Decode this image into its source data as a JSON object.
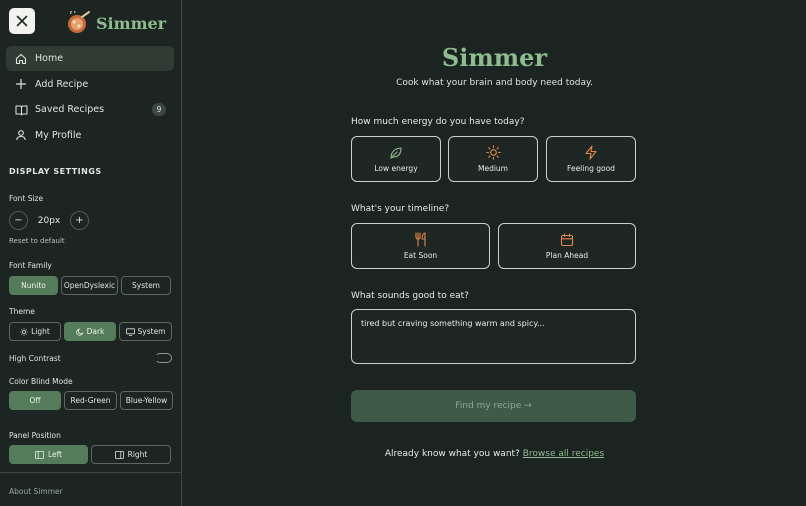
{
  "brand": {
    "name": "Simmer"
  },
  "nav": {
    "items": [
      {
        "label": "Home",
        "icon": "home-icon",
        "active": true
      },
      {
        "label": "Add Recipe",
        "icon": "plus-icon"
      },
      {
        "label": "Saved Recipes",
        "icon": "book-icon",
        "badge": "9"
      },
      {
        "label": "My Profile",
        "icon": "user-icon"
      }
    ]
  },
  "settings": {
    "title": "DISPLAY SETTINGS",
    "font_size": {
      "label": "Font Size",
      "value": "20px",
      "minus": "−",
      "plus": "+",
      "reset": "Reset to default"
    },
    "font_family": {
      "label": "Font Family",
      "options": [
        "Nunito",
        "OpenDyslexic",
        "System"
      ],
      "selected": "Nunito"
    },
    "theme": {
      "label": "Theme",
      "options": [
        "Light",
        "Dark",
        "System"
      ],
      "selected": "Dark"
    },
    "high_contrast": {
      "label": "High Contrast",
      "enabled": false
    },
    "color_blind": {
      "label": "Color Blind Mode",
      "options": [
        "Off",
        "Red-Green",
        "Blue-Yellow"
      ],
      "selected": "Off"
    },
    "panel_position": {
      "label": "Panel Position",
      "options": [
        "Left",
        "Right"
      ],
      "selected": "Left"
    },
    "about": "About Simmer"
  },
  "main": {
    "title": "Simmer",
    "subtitle": "Cook what your brain and body need today.",
    "energy": {
      "question": "How much energy do you have today?",
      "options": [
        {
          "label": "Low energy",
          "icon": "leaf-icon"
        },
        {
          "label": "Medium",
          "icon": "sun-icon"
        },
        {
          "label": "Feeling good",
          "icon": "lightning-icon"
        }
      ]
    },
    "timeline": {
      "question": "What's your timeline?",
      "options": [
        {
          "label": "Eat Soon",
          "icon": "utensils-icon"
        },
        {
          "label": "Plan Ahead",
          "icon": "calendar-icon"
        }
      ]
    },
    "craving": {
      "question": "What sounds good to eat?",
      "value": "tired but craving something warm and spicy..."
    },
    "find_button": "Find my recipe →",
    "browse": {
      "prefix": "Already know what you want?",
      "link": "Browse all recipes"
    }
  },
  "colors": {
    "accent": "#8fbb90",
    "selected": "#557c5a",
    "background": "#1b2420",
    "icon_orange": "#e0874a"
  }
}
